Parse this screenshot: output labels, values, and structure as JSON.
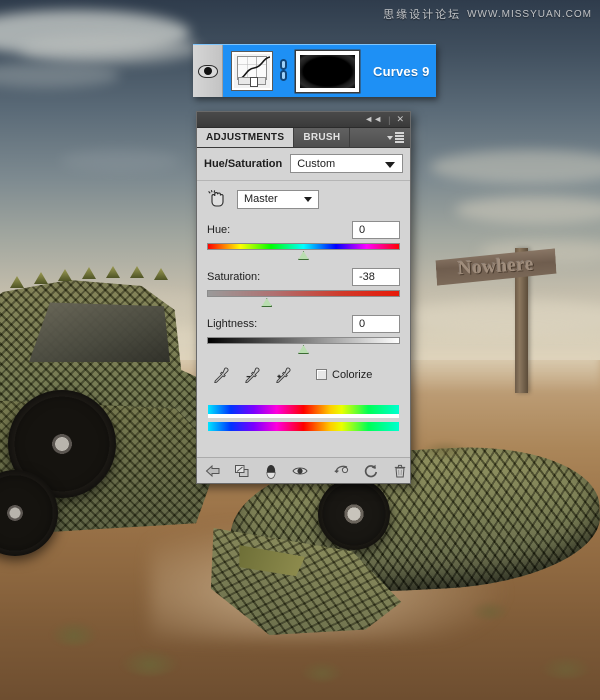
{
  "watermark": {
    "cn_text": "思缘设计论坛",
    "url_text": "WWW.MISSYUAN.COM"
  },
  "background": {
    "sign_text": "Nowhere",
    "scene_description": "Desert landscape with crocodile-skin textured vintage car and a wooden Nowhere sign"
  },
  "layer_row": {
    "name": "Curves 9",
    "visibility_icon": "eye-icon",
    "thumbnail_icon": "curves-thumbnail",
    "link_icon": "link-chain-icon",
    "mask_icon": "layer-mask-thumbnail",
    "selected_color": "#1e90f5"
  },
  "panel": {
    "titlebar": {
      "collapse_label": "◄◄",
      "separator": "|",
      "close_label": "✕"
    },
    "tabs": [
      {
        "label": "ADJUSTMENTS",
        "active": true
      },
      {
        "label": "BRUSH",
        "active": false
      }
    ],
    "menu_icon": "panel-menu-icon",
    "preset": {
      "label": "Hue/Saturation",
      "value": "Custom"
    },
    "channel": {
      "tat_icon": "targeted-adjustment-tool-icon",
      "value": "Master"
    },
    "sliders": [
      {
        "label": "Hue:",
        "value": "0",
        "position_pct": 50,
        "track": "hue"
      },
      {
        "label": "Saturation:",
        "value": "-38",
        "position_pct": 31,
        "track": "sat"
      },
      {
        "label": "Lightness:",
        "value": "0",
        "position_pct": 50,
        "track": "light"
      }
    ],
    "eyedroppers": [
      "eyedropper-icon",
      "eyedropper-minus-icon",
      "eyedropper-plus-icon"
    ],
    "colorize": {
      "label": "Colorize",
      "checked": false
    },
    "footer_icons": [
      "back-arrow-icon",
      "clip-to-layer-icon",
      "preset-black-white-icon",
      "toggle-visibility-icon",
      "view-previous-state-icon",
      "reset-icon",
      "delete-icon"
    ]
  }
}
